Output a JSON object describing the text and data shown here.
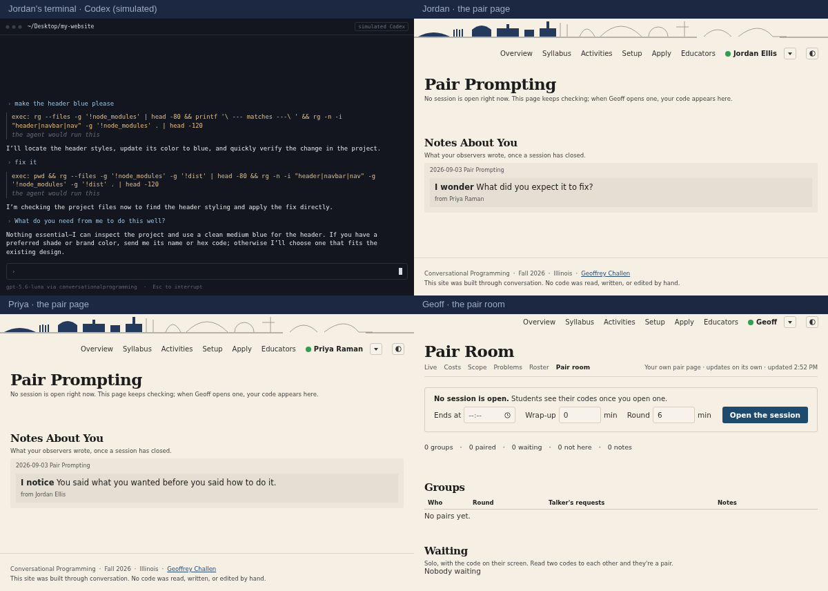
{
  "panes": [
    {
      "kind": "terminal",
      "title": "Jordan's terminal · Codex (simulated)",
      "path": "~/Desktop/my-website",
      "badge": "simulated Codex",
      "marker": "›",
      "lines": [
        {
          "kind": "prompt",
          "text": "make the header blue please"
        },
        {
          "kind": "exec",
          "text": "exec: rg --files -g '!node_modules' | head -80 && printf '\\ --- matches ---\\ ' && rg -n -i \"header|navbar|nav\" -g '!node_modules' . | head -120",
          "note": "the agent would run this"
        },
        {
          "kind": "reply",
          "text": "I’ll locate the header styles, update its color to blue, and quickly verify the change in the project."
        },
        {
          "kind": "prompt",
          "text": "fix it"
        },
        {
          "kind": "exec",
          "text": "exec: pwd && rg --files -g '!node_modules' -g '!dist' | head -80 && rg -n -i \"header|navbar|nav\" -g '!node_modules' -g '!dist' . | head -120",
          "note": "the agent would run this"
        },
        {
          "kind": "reply",
          "text": "I’m checking the project files now to find the header styling and apply the fix directly."
        },
        {
          "kind": "prompt",
          "text": "What do you need from me to do this well?"
        },
        {
          "kind": "reply",
          "text": "Nothing essential—I can inspect the project and use a clean medium blue for the header. If you have a preferred shade or brand color, send me its name or hex code; otherwise I’ll choose one that fits the existing design."
        }
      ],
      "status": "gpt-5.6-luna via conversationalprogramming  ·  Esc to interrupt"
    },
    {
      "kind": "pair_page",
      "title": "Jordan · the pair page",
      "skyline": true,
      "nav": [
        "Overview",
        "Syllabus",
        "Activities",
        "Setup",
        "Apply",
        "Educators"
      ],
      "user": {
        "name": "Jordan Ellis",
        "online": true
      },
      "heading": "Pair Prompting",
      "subtitle": "No session is open right now. This page keeps checking; when Geoff opens one, your code appears here.",
      "notes_heading": "Notes About You",
      "notes_subtitle": "What your observers wrote, once a session has closed.",
      "notes": [
        {
          "date": "2026-09-03 Pair Prompting",
          "text": "**I wonder** What did you expect it to fix?",
          "from": "from Priya Raman"
        }
      ],
      "footer": {
        "parts": [
          "Conversational Programming",
          "Fall 2026",
          "Illinois"
        ],
        "separator": "·",
        "link": "Geoffrey Challen",
        "note": "This site was built through conversation. No code was read, written, or edited by hand."
      }
    },
    {
      "kind": "pair_page",
      "title": "Priya · the pair page",
      "skyline": true,
      "nav": [
        "Overview",
        "Syllabus",
        "Activities",
        "Setup",
        "Apply",
        "Educators"
      ],
      "user": {
        "name": "Priya Raman",
        "online": true
      },
      "heading": "Pair Prompting",
      "subtitle": "No session is open right now. This page keeps checking; when Geoff opens one, your code appears here.",
      "notes_heading": "Notes About You",
      "notes_subtitle": "What your observers wrote, once a session has closed.",
      "notes": [
        {
          "date": "2026-09-03 Pair Prompting",
          "text": "**I notice** You said what you wanted before you said how to do it.",
          "from": "from Jordan Ellis"
        }
      ],
      "footer": {
        "parts": [
          "Conversational Programming",
          "Fall 2026",
          "Illinois"
        ],
        "separator": "·",
        "link": "Geoffrey Challen",
        "note": "This site was built through conversation. No code was read, written, or edited by hand."
      }
    },
    {
      "kind": "pair_room",
      "title": "Geoff · the pair room",
      "nav": [
        "Overview",
        "Syllabus",
        "Activities",
        "Setup",
        "Apply",
        "Educators"
      ],
      "user": {
        "name": "Geoff",
        "online": true
      },
      "heading": "Pair Room",
      "tabs": [
        {
          "label": "Live",
          "selected": false
        },
        {
          "label": "Costs",
          "selected": false
        },
        {
          "label": "Scope",
          "selected": false
        },
        {
          "label": "Problems",
          "selected": false
        },
        {
          "label": "Roster",
          "selected": false
        },
        {
          "label": "Pair room",
          "selected": true
        }
      ],
      "updated": "Your own pair page · updates on its own · updated 2:52 PM",
      "session": {
        "message": "**No session is open.** Students see their codes once you open one.",
        "fields": [
          {
            "kind": "time",
            "label": "Ends at",
            "placeholder": "--:--"
          },
          {
            "kind": "number",
            "label": "Wrap-up",
            "value": "0",
            "unit": "min"
          },
          {
            "kind": "number",
            "label": "Round",
            "value": "6",
            "unit": "min"
          }
        ],
        "button": "Open the session"
      },
      "stats": [
        "0 groups",
        "0 paired",
        "0 waiting",
        "0 not here",
        "0 notes"
      ],
      "separator": "·",
      "groups": {
        "heading": "Groups",
        "columns": [
          "Who",
          "Round",
          "Talker's requests",
          "Notes"
        ],
        "empty": "No pairs yet."
      },
      "waiting": {
        "heading": "Waiting",
        "subtitle": "Solo, with the code on their screen. Read two codes to each other and they're a pair.",
        "empty": "Nobody waiting"
      }
    }
  ]
}
